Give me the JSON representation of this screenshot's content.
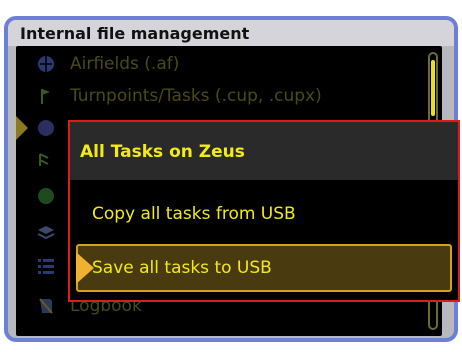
{
  "window": {
    "title": "Internal file management"
  },
  "list": {
    "items": [
      {
        "label": "Airfields (.af)",
        "icon": "globe-icon"
      },
      {
        "label": "Turnpoints/Tasks (.cup, .cupx)",
        "icon": "flag-icon"
      },
      {
        "label": "",
        "icon": "circle-icon"
      },
      {
        "label": "",
        "icon": "route-icon"
      },
      {
        "label": "",
        "icon": "globe-icon"
      },
      {
        "label": "",
        "icon": "layers-icon"
      },
      {
        "label": "",
        "icon": "list-icon"
      },
      {
        "label": "Logbook",
        "icon": "book-icon"
      }
    ]
  },
  "popup": {
    "title": "All Tasks on Zeus",
    "items": [
      {
        "label": "Copy all tasks from USB"
      },
      {
        "label": "Save all tasks to USB"
      }
    ]
  },
  "colors": {
    "accent_yellow": "#f2ea1a",
    "popup_border": "#e01a1a",
    "window_border": "#6d7fd6",
    "active_item_border": "#d8a020"
  }
}
